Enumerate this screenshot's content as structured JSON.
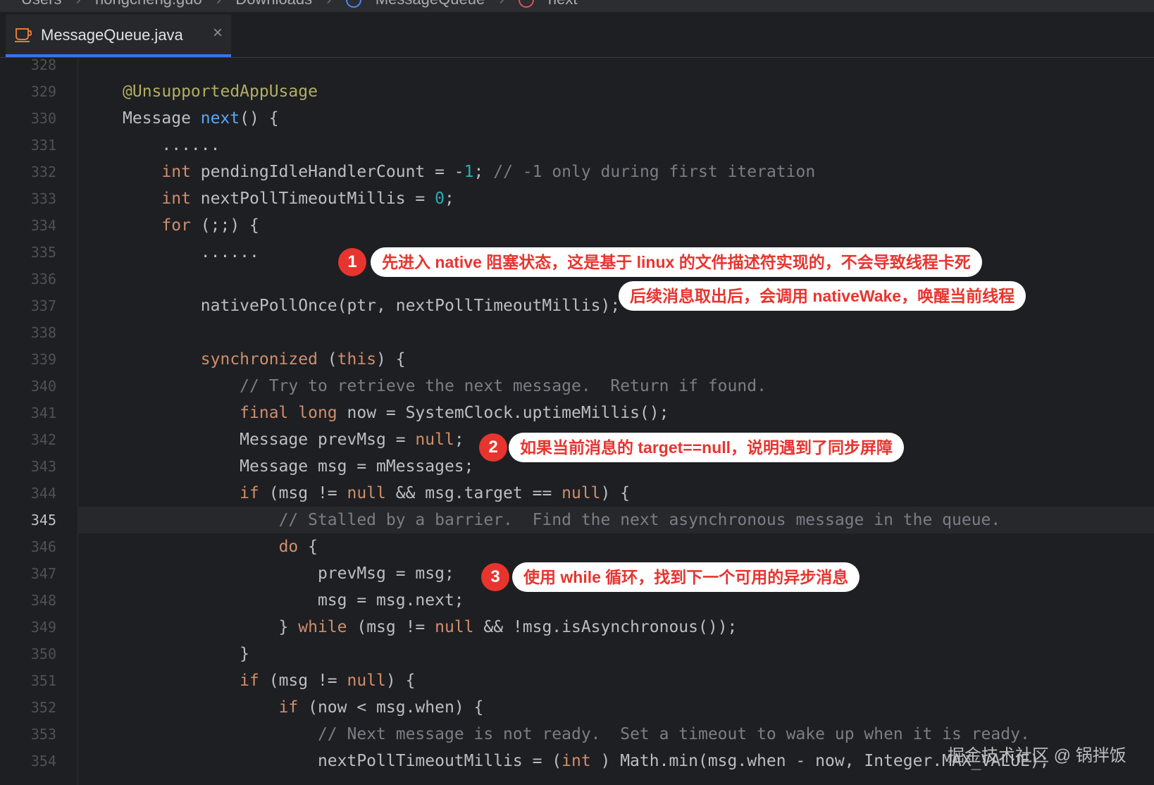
{
  "breadcrumb": {
    "items": [
      "Users",
      "hongcheng.guo",
      "Downloads",
      "MessageQueue",
      "next"
    ],
    "separator": "›"
  },
  "tab": {
    "icon": "java-coffee-cup-icon",
    "label": "MessageQueue.java",
    "close": "×"
  },
  "editor": {
    "current_line": 345,
    "lines": [
      {
        "n": "328"
      },
      {
        "n": "329",
        "code": [
          [
            "ann",
            "@UnsupportedAppUsage"
          ]
        ]
      },
      {
        "n": "330",
        "code": [
          [
            "",
            "Message "
          ],
          [
            "fn",
            "next"
          ],
          [
            "",
            "() {"
          ]
        ]
      },
      {
        "n": "331",
        "code": [
          [
            "",
            "    ......"
          ]
        ]
      },
      {
        "n": "332",
        "code": [
          [
            "",
            "    "
          ],
          [
            "kw",
            "int"
          ],
          [
            "",
            " pendingIdleHandlerCount = -"
          ],
          [
            "num",
            "1"
          ],
          [
            "",
            "; "
          ],
          [
            "cm",
            "// -1 only during first iteration"
          ]
        ]
      },
      {
        "n": "333",
        "code": [
          [
            "",
            "    "
          ],
          [
            "kw",
            "int"
          ],
          [
            "",
            " nextPollTimeoutMillis = "
          ],
          [
            "num",
            "0"
          ],
          [
            "",
            ";"
          ]
        ]
      },
      {
        "n": "334",
        "code": [
          [
            "",
            "    "
          ],
          [
            "kw",
            "for"
          ],
          [
            "",
            " (;;) {"
          ]
        ]
      },
      {
        "n": "335",
        "code": [
          [
            "",
            "        ......"
          ]
        ]
      },
      {
        "n": "336"
      },
      {
        "n": "337",
        "code": [
          [
            "",
            "        nativePollOnce(ptr, nextPollTimeoutMillis);"
          ]
        ]
      },
      {
        "n": "338"
      },
      {
        "n": "339",
        "code": [
          [
            "",
            "        "
          ],
          [
            "kw",
            "synchronized"
          ],
          [
            "",
            " ("
          ],
          [
            "kw",
            "this"
          ],
          [
            "",
            ") {"
          ]
        ]
      },
      {
        "n": "340",
        "code": [
          [
            "",
            "            "
          ],
          [
            "cm",
            "// Try to retrieve the next message.  Return if found."
          ]
        ]
      },
      {
        "n": "341",
        "code": [
          [
            "",
            "            "
          ],
          [
            "kw",
            "final long"
          ],
          [
            "",
            " now = SystemClock.uptimeMillis();"
          ]
        ]
      },
      {
        "n": "342",
        "code": [
          [
            "",
            "            Message prevMsg = "
          ],
          [
            "kw",
            "null"
          ],
          [
            "",
            ";"
          ]
        ]
      },
      {
        "n": "343",
        "code": [
          [
            "",
            "            Message msg = mMessages;"
          ]
        ]
      },
      {
        "n": "344",
        "code": [
          [
            "",
            "            "
          ],
          [
            "kw",
            "if"
          ],
          [
            "",
            " (msg != "
          ],
          [
            "kw",
            "null"
          ],
          [
            "",
            " && msg.target == "
          ],
          [
            "kw",
            "null"
          ],
          [
            "",
            ") {"
          ]
        ]
      },
      {
        "n": "345",
        "code": [
          [
            "",
            "                "
          ],
          [
            "cm",
            "// Stalled by a barrier.  Find the next asynchronous message in the queue."
          ]
        ]
      },
      {
        "n": "346",
        "code": [
          [
            "",
            "                "
          ],
          [
            "kw",
            "do"
          ],
          [
            "",
            " {"
          ]
        ]
      },
      {
        "n": "347",
        "code": [
          [
            "",
            "                    prevMsg = msg;"
          ]
        ]
      },
      {
        "n": "348",
        "code": [
          [
            "",
            "                    msg = msg.next;"
          ]
        ]
      },
      {
        "n": "349",
        "code": [
          [
            "",
            "                } "
          ],
          [
            "kw",
            "while"
          ],
          [
            "",
            " (msg != "
          ],
          [
            "kw",
            "null"
          ],
          [
            "",
            " && !msg.isAsynchronous());"
          ]
        ]
      },
      {
        "n": "350",
        "code": [
          [
            "",
            "            }"
          ]
        ]
      },
      {
        "n": "351",
        "code": [
          [
            "",
            "            "
          ],
          [
            "kw",
            "if"
          ],
          [
            "",
            " (msg != "
          ],
          [
            "kw",
            "null"
          ],
          [
            "",
            ") {"
          ]
        ]
      },
      {
        "n": "352",
        "code": [
          [
            "",
            "                "
          ],
          [
            "kw",
            "if"
          ],
          [
            "",
            " (now < msg.when) {"
          ]
        ]
      },
      {
        "n": "353",
        "code": [
          [
            "",
            "                    "
          ],
          [
            "cm",
            "// Next message is not ready.  Set a timeout to wake up when it is ready."
          ]
        ]
      },
      {
        "n": "354",
        "code": [
          [
            "",
            "                    nextPollTimeoutMillis = ("
          ],
          [
            "kw",
            "int"
          ],
          [
            "",
            " ) Math.min(msg.when - now, Integer.MAX_VALUE);"
          ]
        ]
      }
    ]
  },
  "annotations": [
    {
      "badge": "1",
      "text": "先进入 native 阻塞状态，这是基于 linux 的文件描述符实现的，不会导致线程卡死"
    },
    {
      "text": "后续消息取出后，会调用 nativeWake，唤醒当前线程"
    },
    {
      "badge": "2",
      "text": "如果当前消息的 target==null，说明遇到了同步屏障"
    },
    {
      "badge": "3",
      "text": "使用 while 循环，找到下一个可用的异步消息"
    }
  ],
  "watermark": "掘金技术社区 @ 锅拌饭",
  "colors": {
    "background": "#1e1f22",
    "keyword": "#cf8e6d",
    "number": "#2aacb8",
    "comment": "#7a7e85",
    "annotation_red": "#e8342f",
    "tab_underline": "#3574f0"
  }
}
